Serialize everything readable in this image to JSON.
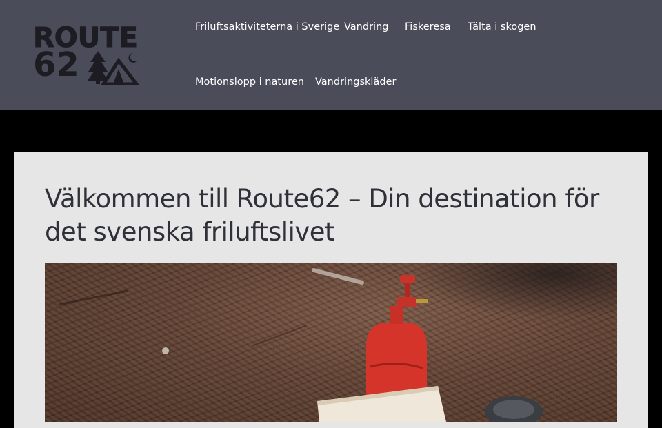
{
  "logo": {
    "line1": "ROUTE",
    "line2": "62"
  },
  "nav": {
    "items": [
      {
        "label": "Friluftsaktiviteterna i Sverige"
      },
      {
        "label": "Vandring"
      },
      {
        "label": "Fiskeresa"
      },
      {
        "label": "Tälta i skogen"
      },
      {
        "label": "Motionslopp i naturen"
      },
      {
        "label": "Vandringskläder"
      }
    ]
  },
  "main": {
    "title": "Välkommen till Route62 – Din destination för det svenska friluftslivet"
  },
  "colors": {
    "header_bg": "#4a4d59",
    "page_bg": "#000000",
    "card_bg": "#e6e6e6",
    "title_text": "#2f3038",
    "nav_text": "#ffffff"
  },
  "icons": [
    "tree-icon",
    "tent-icon",
    "moon-icon"
  ]
}
